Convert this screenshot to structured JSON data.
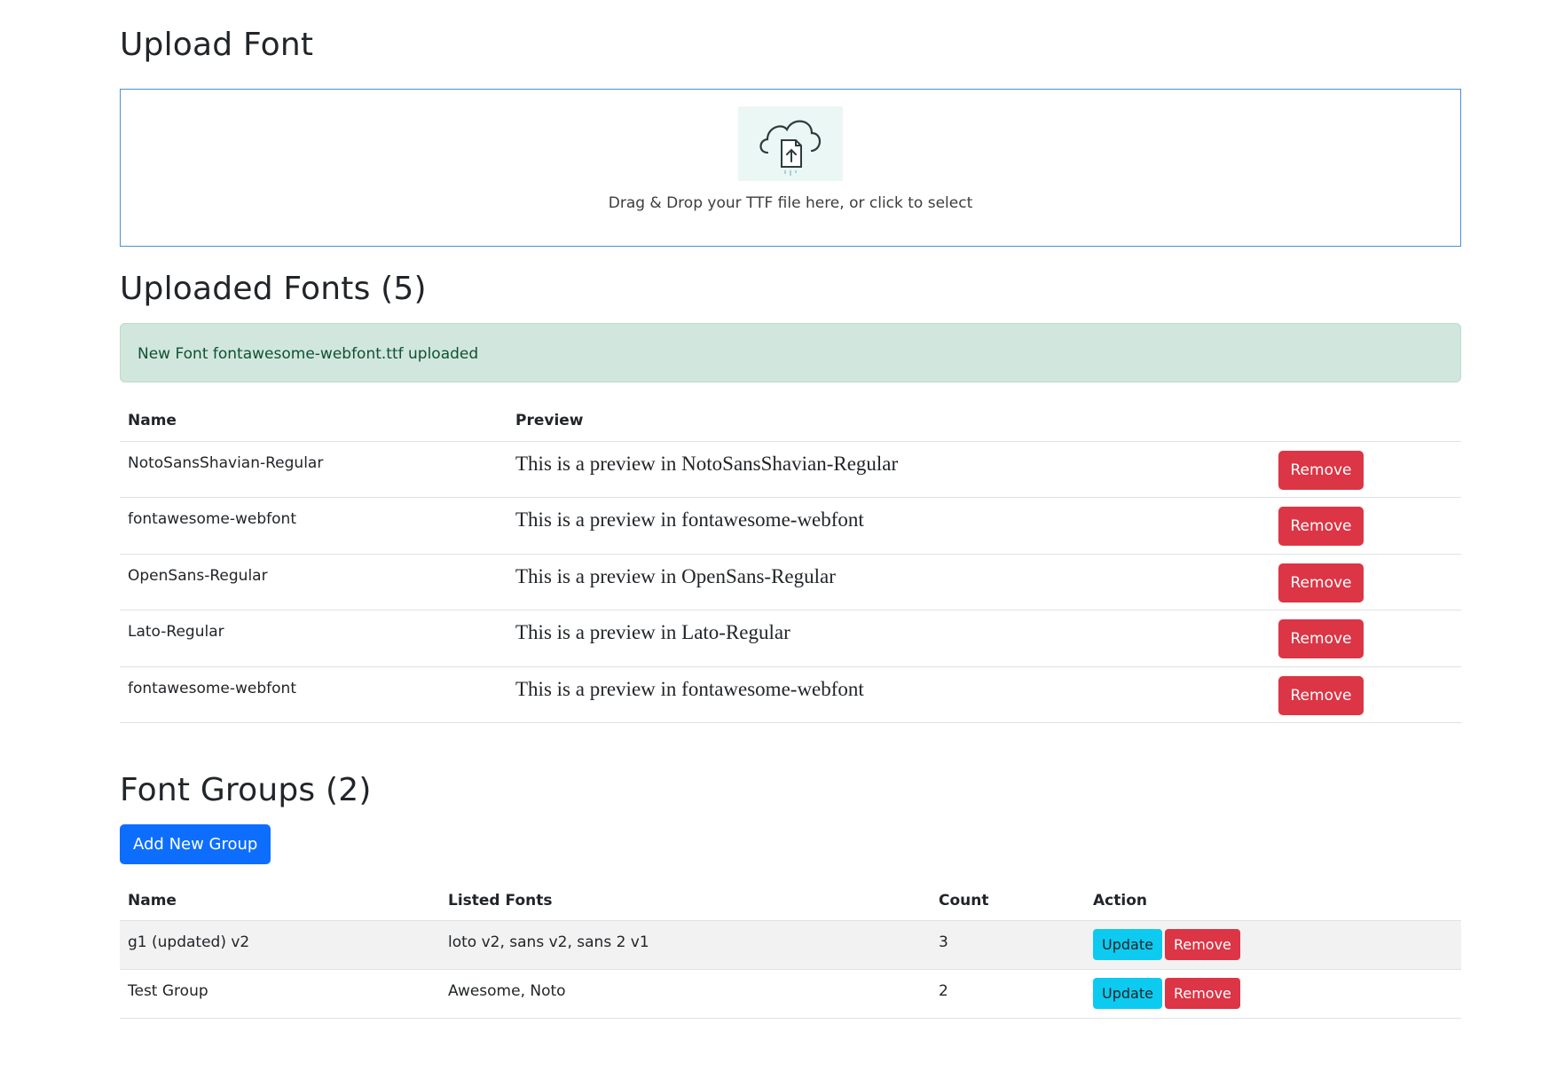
{
  "upload": {
    "title": "Upload Font",
    "dropzone_text": "Drag & Drop your TTF file here, or click to select",
    "icon": "cloud-upload-icon"
  },
  "uploaded": {
    "title": "Uploaded Fonts (5)",
    "alert": "New Font fontawesome-webfont.ttf uploaded",
    "headers": {
      "name": "Name",
      "preview": "Preview"
    },
    "rows": [
      {
        "name": "NotoSansShavian-Regular",
        "preview": "This is a preview in NotoSansShavian-Regular",
        "remove": "Remove"
      },
      {
        "name": "fontawesome-webfont",
        "preview": "This is a preview in fontawesome-webfont",
        "remove": "Remove"
      },
      {
        "name": "OpenSans-Regular",
        "preview": "This is a preview in OpenSans-Regular",
        "remove": "Remove"
      },
      {
        "name": "Lato-Regular",
        "preview": "This is a preview in Lato-Regular",
        "remove": "Remove"
      },
      {
        "name": "fontawesome-webfont",
        "preview": "This is a preview in fontawesome-webfont",
        "remove": "Remove"
      }
    ]
  },
  "groups": {
    "title": "Font Groups (2)",
    "add_button": "Add New Group",
    "headers": {
      "name": "Name",
      "listed": "Listed Fonts",
      "count": "Count",
      "action": "Action"
    },
    "rows": [
      {
        "name": "g1 (updated) v2",
        "listed": "loto v2, sans v2, sans 2 v1",
        "count": "3",
        "update": "Update",
        "remove": "Remove"
      },
      {
        "name": "Test Group",
        "listed": "Awesome, Noto",
        "count": "2",
        "update": "Update",
        "remove": "Remove"
      }
    ]
  },
  "colors": {
    "primary": "#0d6efd",
    "danger": "#dc3545",
    "info": "#0dcaf0",
    "success_bg": "#d1e7dd",
    "dropzone_border": "#4a90d9"
  }
}
